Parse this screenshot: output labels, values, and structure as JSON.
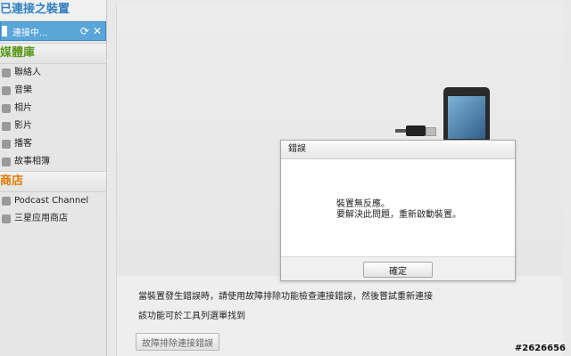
{
  "sidebar": {
    "connected_title": "已連接之裝置",
    "device_label": "連接中...",
    "library_title": "媒體庫",
    "library_items": [
      "聯絡人",
      "音樂",
      "相片",
      "影片",
      "播客",
      "故事相簿"
    ],
    "store_title": "商店",
    "store_items": [
      "Podcast Channel",
      "三星应用商店"
    ]
  },
  "main": {
    "hint_line1": "當裝置發生錯誤時，請使用故障排除功能檢查連接錯誤，然後嘗試重新連接",
    "hint_line2": "該功能可於工具列選單找到",
    "trouble_button": "故障排除連接錯誤"
  },
  "dialog": {
    "title": "錯誤",
    "line1": "裝置無反應。",
    "line2": "要解決此問題，重新啟動裝置。",
    "ok_label": "確定"
  },
  "watermark": "#2626656"
}
